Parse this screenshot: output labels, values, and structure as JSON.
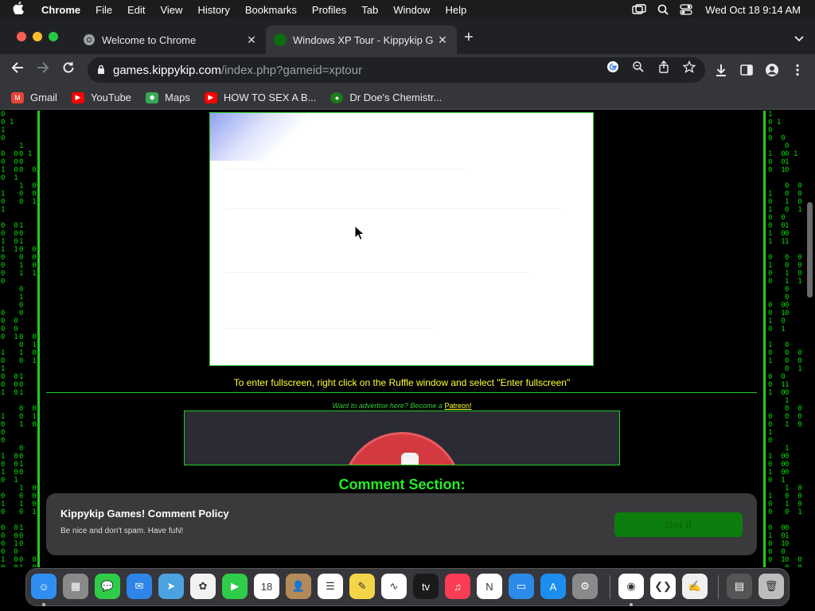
{
  "menubar": {
    "app": "Chrome",
    "items": [
      "File",
      "Edit",
      "View",
      "History",
      "Bookmarks",
      "Profiles",
      "Tab",
      "Window",
      "Help"
    ],
    "clock": "Wed Oct 18  9:14 AM"
  },
  "tabs": [
    {
      "title": "Welcome to Chrome",
      "close": "✕"
    },
    {
      "title": "Windows XP Tour - Kippykip G",
      "close": "✕"
    }
  ],
  "newtab": "+",
  "address": {
    "host": "games.kippykip.com",
    "path": "/index.php?gameid=xptour"
  },
  "bookmarks": [
    {
      "label": "Gmail",
      "icon": "gmail-icon",
      "color": "#ea4335",
      "glyph": "M"
    },
    {
      "label": "YouTube",
      "icon": "youtube-icon",
      "color": "#ff0000",
      "glyph": "▶"
    },
    {
      "label": "Maps",
      "icon": "maps-icon",
      "color": "#34a853",
      "glyph": "◆"
    },
    {
      "label": "HOW TO SEX A B...",
      "icon": "youtube-icon",
      "color": "#ff0000",
      "glyph": "▶"
    },
    {
      "label": "Dr Doe's Chemistr...",
      "icon": "site-icon",
      "color": "#1b7a1b",
      "glyph": "●"
    }
  ],
  "page": {
    "fullscreen_note": "To enter fullscreen, right click on the Ruffle window and select \"Enter fullscreen\"",
    "advertise_text": "Want to advertise here? Become a ",
    "advertise_link": "Patreon!",
    "comment_heading": "Comment Section:"
  },
  "policy": {
    "title": "Kippykip Games! Comment Policy",
    "description": "Be nice and don't spam. Have fuN!",
    "button": "Got it"
  },
  "matrix": {
    "left": "0\n0 1\n1\n0\n\n0  0\n0  0\n1  0\n0  1\n\n1\n0\n1\n\n0  0\n0  0\n1  0\n1  1\n0\n0\n0\n0\n\n\n\n0\n0  0\n0  0\n0  1\n\n1\n0\n1\n0  0\n0  0\n1  0\n\n\n1\n0\n0\n0\n\n1  0\n0  0\n1  0\n0  1\n\n0\n1\n0\n\n0  0\n0  0\n0  1\n0  0\n1  0\n0  0",
    "right": "1\n0 1\n0\n0  0\n\n1  0\n0  0\n0  1\n\n\n1\n0\n1\n0  0\n0  0\n1  0\n1  1\n\n0\n1\n0\n0\n\n\n0  0\n0  1\n1  0\n0  1\n\n1\n0\n1\n\n0  0\n0  1\n1  0\n\n\n0\n0\n1\n0\n\n1  0\n0  0\n1  0\n0  1\n\n1\n0\n0\n\n0  0\n1  0\n0  1\n0  0\n0  1"
  },
  "dock": [
    {
      "name": "finder-icon",
      "color": "#2f8ff0",
      "glyph": "☺"
    },
    {
      "name": "launchpad-icon",
      "color": "#8a8a8a",
      "glyph": "▦"
    },
    {
      "name": "messages-icon",
      "color": "#2fcc4a",
      "glyph": "💬"
    },
    {
      "name": "mail-icon",
      "color": "#2e84e8",
      "glyph": "✉"
    },
    {
      "name": "maps-icon",
      "color": "#4aa3e0",
      "glyph": "➤"
    },
    {
      "name": "photos-icon",
      "color": "#f2f2f2",
      "glyph": "✿"
    },
    {
      "name": "facetime-icon",
      "color": "#2fcc4a",
      "glyph": "▶"
    },
    {
      "name": "calendar-icon",
      "color": "#ffffff",
      "glyph": "18"
    },
    {
      "name": "contacts-icon",
      "color": "#b38b5a",
      "glyph": "👤"
    },
    {
      "name": "reminders-icon",
      "color": "#ffffff",
      "glyph": "☰"
    },
    {
      "name": "notes-icon",
      "color": "#f4d54a",
      "glyph": "✎"
    },
    {
      "name": "freeform-icon",
      "color": "#ffffff",
      "glyph": "∿"
    },
    {
      "name": "tv-icon",
      "color": "#1a1a1a",
      "glyph": "tv"
    },
    {
      "name": "music-icon",
      "color": "#fa3c55",
      "glyph": "♫"
    },
    {
      "name": "news-icon",
      "color": "#ffffff",
      "glyph": "N"
    },
    {
      "name": "keynote-icon",
      "color": "#2c8ae8",
      "glyph": "▭"
    },
    {
      "name": "app-store-icon",
      "color": "#1d8df0",
      "glyph": "A"
    },
    {
      "name": "system-settings-icon",
      "color": "#8a8a8a",
      "glyph": "⚙"
    },
    {
      "name": "chrome-icon",
      "color": "#ffffff",
      "glyph": "◉"
    },
    {
      "name": "vscode-icon",
      "color": "#ffffff",
      "glyph": "❮❯"
    },
    {
      "name": "textedit-icon",
      "color": "#f0f0f0",
      "glyph": "✍"
    },
    {
      "name": "downloads-stack-icon",
      "color": "#555555",
      "glyph": "▤"
    },
    {
      "name": "trash-icon",
      "color": "#bdbdbd",
      "glyph": "🗑"
    }
  ]
}
